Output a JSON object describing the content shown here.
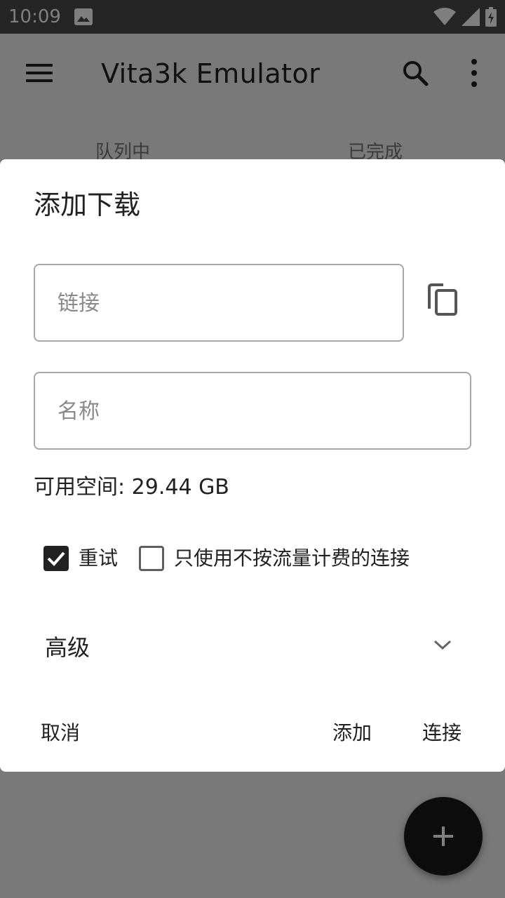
{
  "status_bar": {
    "time": "10:09",
    "icons": [
      "image-icon",
      "wifi-icon",
      "signal-icon",
      "battery-icon"
    ]
  },
  "app_bar": {
    "title": "Vita3k Emulator",
    "icons": [
      "menu-icon",
      "search-icon",
      "more-vert-icon"
    ]
  },
  "tabs": [
    {
      "label": "队列中"
    },
    {
      "label": "已完成"
    }
  ],
  "dialog": {
    "title": "添加下载",
    "link_field": {
      "placeholder": "链接",
      "value": ""
    },
    "name_field": {
      "placeholder": "名称",
      "value": ""
    },
    "available_space": "可用空间: 29.44 GB",
    "options": [
      {
        "label": "重试",
        "checked": true
      },
      {
        "label": "只使用不按流量计费的连接",
        "checked": false
      }
    ],
    "advanced": {
      "label": "高级",
      "expanded": false
    },
    "buttons": {
      "cancel": "取消",
      "add": "添加",
      "connect": "连接"
    }
  },
  "fab": {
    "icon": "plus-icon"
  },
  "colors": {
    "scrim": "#000000",
    "dialog_bg": "#ffffff",
    "checkbox_checked": "#212121",
    "fab": "#1a1a1a"
  }
}
